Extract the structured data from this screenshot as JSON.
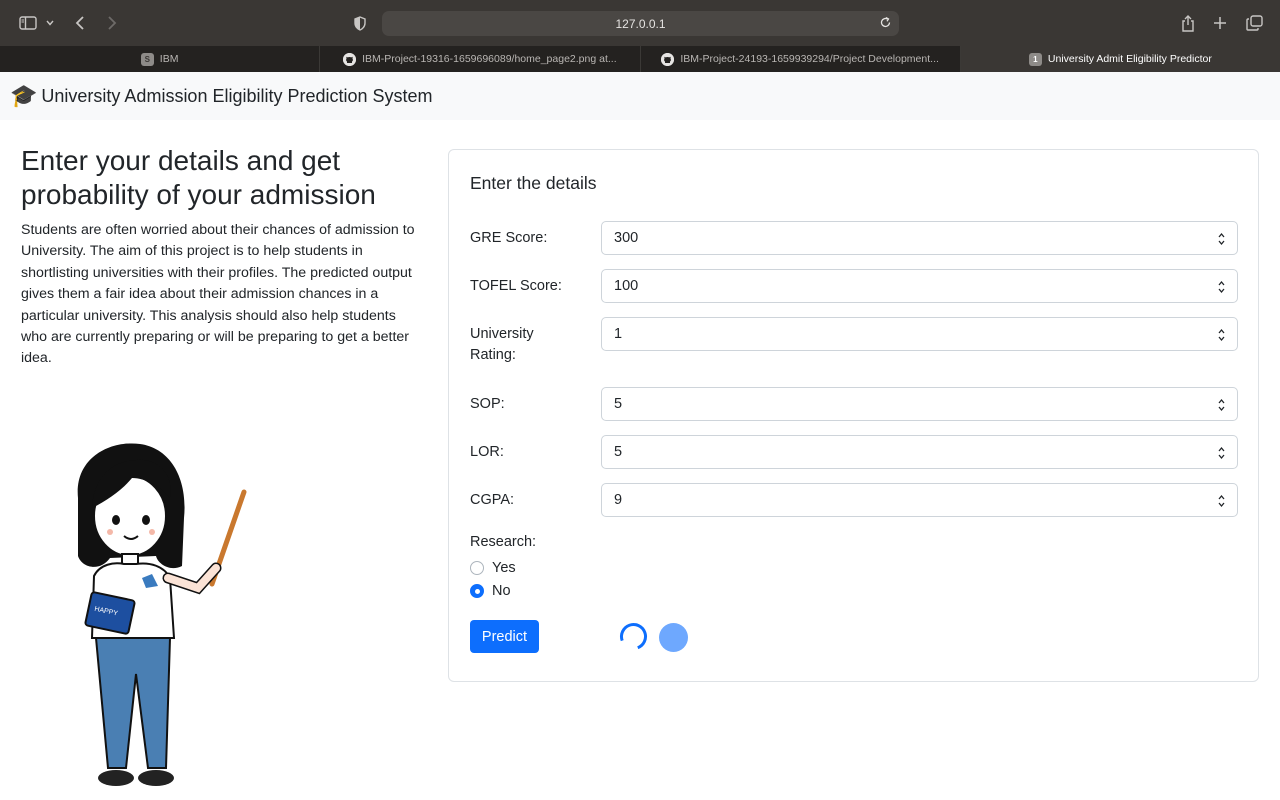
{
  "browser": {
    "url": "127.0.0.1",
    "tabs": [
      {
        "label": "IBM",
        "favicon": "S",
        "active": false
      },
      {
        "label": "IBM-Project-19316-1659696089/home_page2.png at...",
        "favicon": "github-icon",
        "active": false
      },
      {
        "label": "IBM-Project-24193-1659939294/Project Development...",
        "favicon": "github-icon",
        "active": false
      },
      {
        "label": "University Admit Eligibility Predictor",
        "favicon": "1",
        "active": true
      }
    ]
  },
  "navbar": {
    "brand_icon": "🎓",
    "brand": "University Admission Eligibility Prediction System"
  },
  "intro": {
    "heading": "Enter your details and get probability of your admission",
    "body": "Students are often worried about their chances of admission to University. The aim of this project is to help students in shortlisting universities with their profiles. The predicted output gives them a fair idea about their admission chances in a particular university. This analysis should also help students who are currently preparing or will be preparing to get a better idea."
  },
  "form": {
    "title": "Enter the details",
    "fields": [
      {
        "label": "GRE Score:",
        "value": "300"
      },
      {
        "label": "TOFEL Score:",
        "value": "100"
      },
      {
        "label": "University Rating:",
        "value": "1"
      },
      {
        "label": "SOP:",
        "value": "5"
      },
      {
        "label": "LOR:",
        "value": "5"
      },
      {
        "label": "CGPA:",
        "value": "9"
      }
    ],
    "research_label": "Research:",
    "research_options": [
      {
        "label": "Yes",
        "checked": false
      },
      {
        "label": "No",
        "checked": true
      }
    ],
    "submit_label": "Predict"
  },
  "colors": {
    "accent": "#0d6efd",
    "navbar_bg": "#f8f9fa",
    "browser_chrome": "#3a3734"
  }
}
